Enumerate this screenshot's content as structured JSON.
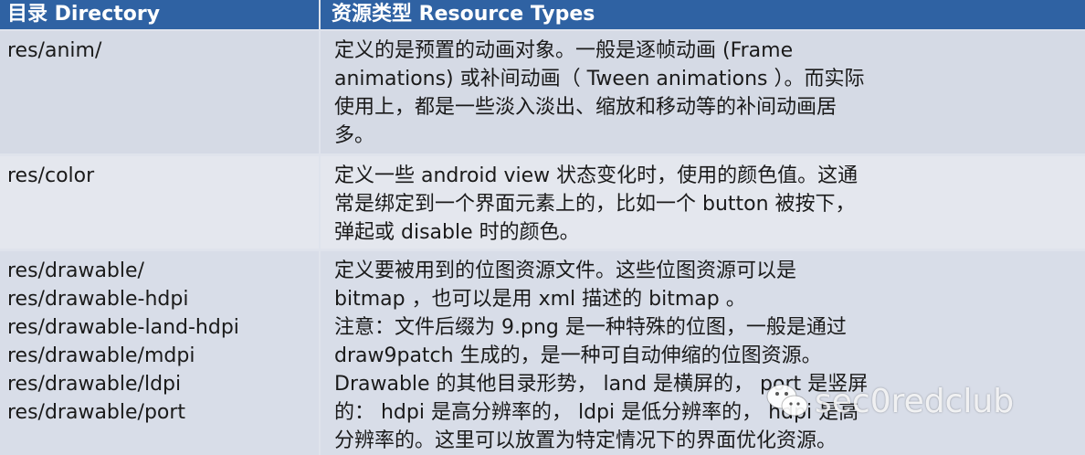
{
  "header": {
    "directory": "目录 Directory",
    "resource_types": "资源类型 Resource Types"
  },
  "rows": [
    {
      "dirs": [
        "res/anim/"
      ],
      "desc": [
        "定义的是预置的动画对象。一般是逐帧动画 (Frame",
        "animations) 或补间动画（ Tween animations ）。而实际",
        "使用上，都是一些淡入淡出、缩放和移动等的补间动画居",
        "多。"
      ]
    },
    {
      "dirs": [
        "res/color"
      ],
      "desc": [
        "定义一些 android view 状态变化时，使用的颜色值。这通",
        "常是绑定到一个界面元素上的，比如一个 button 被按下，",
        "弹起或 disable 时的颜色。"
      ]
    },
    {
      "dirs": [
        "res/drawable/",
        "res/drawable-hdpi",
        "res/drawable-land-hdpi",
        "res/drawable/mdpi",
        "res/drawable/ldpi",
        "res/drawable/port"
      ],
      "desc": [
        "定义要被用到的位图资源文件。这些位图资源可以是",
        "bitmap ，也可以是用 xml 描述的 bitmap 。",
        "注意：文件后缀为 9.png 是一种特殊的位图，一般是通过",
        "draw9patch 生成的，是一种可自动伸缩的位图资源。",
        "Drawable 的其他目录形势， land 是横屏的， port 是竖屏",
        "的： hdpi 是高分辨率的， ldpi 是低分辨率的， hdpi 是高",
        "分辨率的。这里可以放置为特定情况下的界面优化资源。"
      ]
    }
  ],
  "watermark": "sec0redclub"
}
